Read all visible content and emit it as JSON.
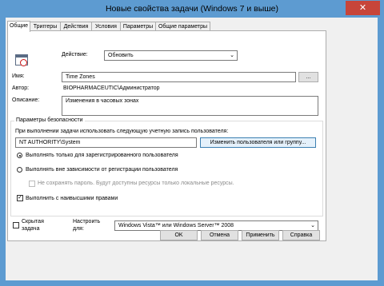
{
  "window": {
    "title": "Новые свойства задачи (Windows 7 и выше)",
    "close_glyph": "✕"
  },
  "tabs": [
    "Общие",
    "Триггеры",
    "Действия",
    "Условия",
    "Параметры",
    "Общие параметры"
  ],
  "general": {
    "action_label": "Действие:",
    "action_value": "Обновить",
    "name_label": "Имя:",
    "name_value": "Time Zones",
    "browse_label": "...",
    "author_label": "Автор:",
    "author_value": "BIOPHARMACEUTIC\\Администратор",
    "description_label": "Описание:",
    "description_value": "Изменения в часовых зонах"
  },
  "security": {
    "group_label": "Параметры безопасности",
    "run_as_label": "При выполнении задачи использовать следующую учетную запись пользователя:",
    "account_value": "NT AUTHORITY\\System",
    "change_user_label": "Изменить пользователя или группу...",
    "radio_logged_on": "Выполнять только для зарегистрированного пользователя",
    "radio_any": "Выполнять вне зависимости от регистрации пользователя",
    "no_store_password": "Не сохранять пароль. Будут доступны ресурсы только локальные ресурсы.",
    "highest_privileges": "Выполнить с наивысшими правами"
  },
  "bottom": {
    "hidden_label_1": "Скрытая",
    "hidden_label_2": "задача",
    "configure_label_1": "Настроить",
    "configure_label_2": "для:",
    "configure_value": "Windows Vista™ или Windows Server™ 2008"
  },
  "buttons": {
    "ok": "OK",
    "cancel": "Отмена",
    "apply": "Применить",
    "help": "Справка"
  },
  "icons": {
    "task": "task-clock-icon",
    "dropdown": "chevron-down-icon"
  }
}
